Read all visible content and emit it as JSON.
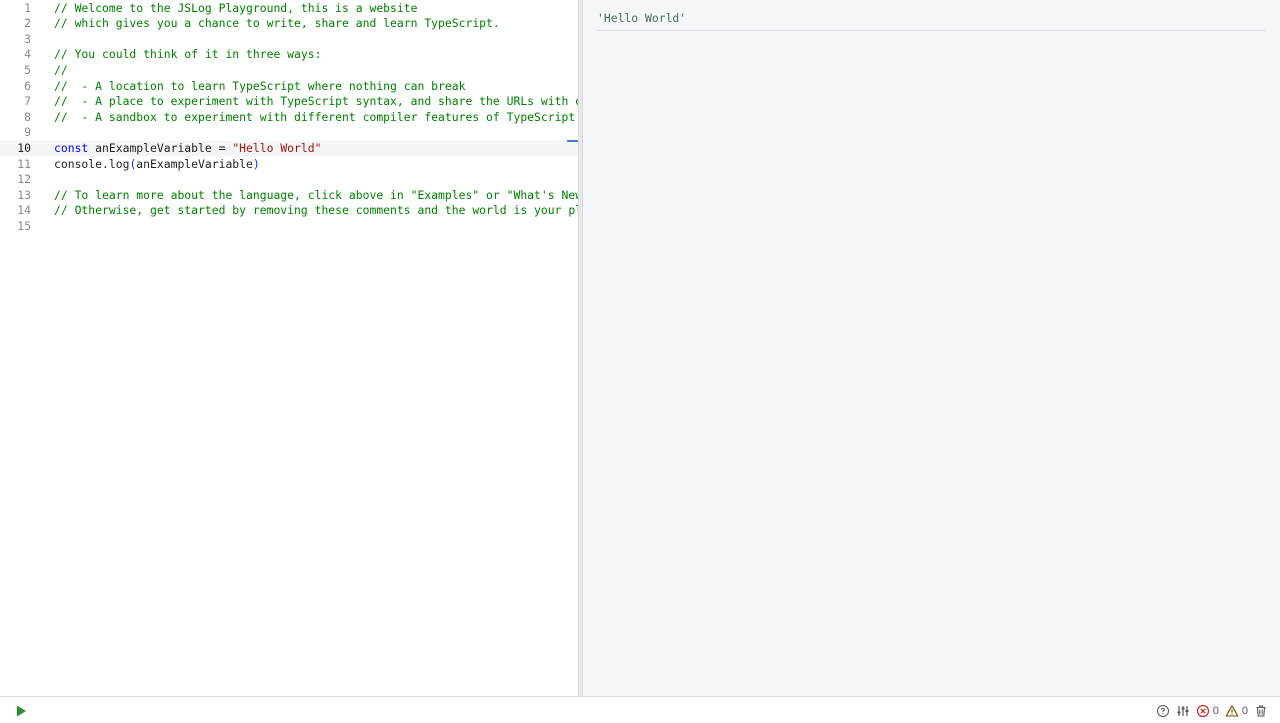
{
  "editor": {
    "lines": [
      {
        "num": "1",
        "tokens": [
          {
            "t": "comment",
            "v": "// Welcome to the JSLog Playground, this is a website"
          }
        ]
      },
      {
        "num": "2",
        "tokens": [
          {
            "t": "comment",
            "v": "// which gives you a chance to write, share and learn TypeScript."
          }
        ]
      },
      {
        "num": "3",
        "tokens": []
      },
      {
        "num": "4",
        "tokens": [
          {
            "t": "comment",
            "v": "// You could think of it in three ways:"
          }
        ]
      },
      {
        "num": "5",
        "tokens": [
          {
            "t": "comment",
            "v": "//"
          }
        ]
      },
      {
        "num": "6",
        "tokens": [
          {
            "t": "comment",
            "v": "//  - A location to learn TypeScript where nothing can break"
          }
        ]
      },
      {
        "num": "7",
        "tokens": [
          {
            "t": "comment",
            "v": "//  - A place to experiment with TypeScript syntax, and share the URLs with others"
          }
        ]
      },
      {
        "num": "8",
        "tokens": [
          {
            "t": "comment",
            "v": "//  - A sandbox to experiment with different compiler features of TypeScript"
          }
        ]
      },
      {
        "num": "9",
        "tokens": []
      },
      {
        "num": "10",
        "active": true,
        "tokens": [
          {
            "t": "keyword",
            "v": "const"
          },
          {
            "t": "ident",
            "v": " anExampleVariable = "
          },
          {
            "t": "string",
            "v": "\"Hello World\""
          }
        ]
      },
      {
        "num": "11",
        "tokens": [
          {
            "t": "ident",
            "v": "console.log"
          },
          {
            "t": "paren",
            "v": "("
          },
          {
            "t": "ident",
            "v": "anExampleVariable"
          },
          {
            "t": "paren",
            "v": ")"
          }
        ]
      },
      {
        "num": "12",
        "tokens": []
      },
      {
        "num": "13",
        "tokens": [
          {
            "t": "comment",
            "v": "// To learn more about the language, click above in \"Examples\" or \"What's New\"."
          }
        ]
      },
      {
        "num": "14",
        "tokens": [
          {
            "t": "comment",
            "v": "// Otherwise, get started by removing these comments and the world is your playground."
          }
        ]
      },
      {
        "num": "15",
        "tokens": []
      }
    ]
  },
  "console": {
    "entries": [
      "'Hello World'"
    ]
  },
  "toolbar": {
    "error_count": "0",
    "warning_count": "0",
    "colors": {
      "run": "#2e8b2e",
      "error": "#c62828",
      "warning": "#6b4e00",
      "icon": "#555555"
    },
    "icons": [
      "play-icon",
      "help-icon",
      "settings-sliders-icon",
      "error-icon",
      "warning-icon",
      "trash-icon"
    ]
  }
}
